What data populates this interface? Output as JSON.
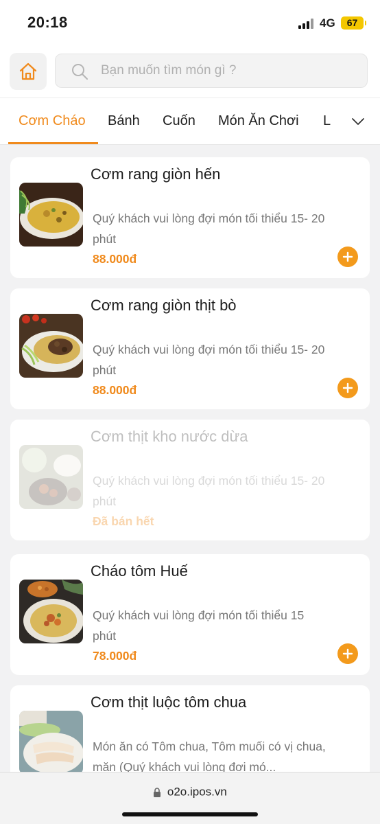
{
  "status": {
    "time": "20:18",
    "network": "4G",
    "battery": "67"
  },
  "search": {
    "placeholder": "Bạn muốn tìm món gì ?"
  },
  "tabs": [
    {
      "label": "Cơm Cháo",
      "active": true
    },
    {
      "label": "Bánh"
    },
    {
      "label": "Cuốn"
    },
    {
      "label": "Món Ăn Chơi"
    },
    {
      "label": "L"
    }
  ],
  "items": [
    {
      "name": "Cơm rang giòn hến",
      "desc": "Quý khách vui lòng đợi món tối thiểu 15- 20 phút",
      "price": "88.000đ",
      "sold_out": false
    },
    {
      "name": "Cơm rang giòn thịt bò",
      "desc": "Quý khách vui lòng đợi món tối thiểu 15- 20 phút",
      "price": "88.000đ",
      "sold_out": false
    },
    {
      "name": "Cơm thịt kho nước dừa",
      "desc": "Quý khách vui lòng đợi món tối thiểu 15- 20 phút",
      "price": "Đã bán hết",
      "sold_out": true
    },
    {
      "name": "Cháo tôm Huế",
      "desc": "Quý khách vui lòng đợi món tối thiểu 15 phút",
      "price": "78.000đ",
      "sold_out": false
    },
    {
      "name": "Cơm thịt luộc tôm chua",
      "desc": "Món ăn có Tôm chua, Tôm muối có vị chua, mặn (Quý khách vui lòng đợi mó...",
      "price": "",
      "sold_out": false
    }
  ],
  "browser": {
    "url": "o2o.ipos.vn"
  },
  "colors": {
    "accent": "#f08a1c",
    "background": "#f2f2f3"
  }
}
